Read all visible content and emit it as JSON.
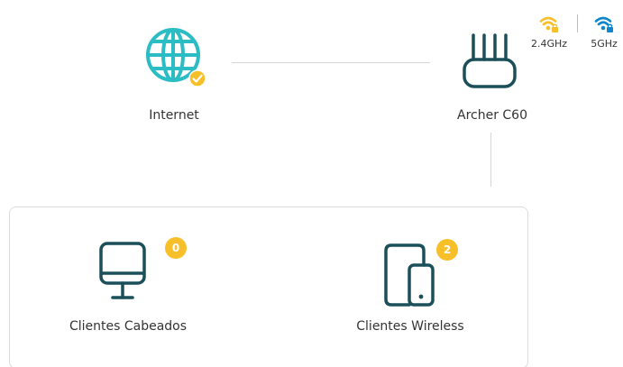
{
  "nodes": {
    "internet": {
      "label": "Internet",
      "status": "connected"
    },
    "router": {
      "label": "Archer C60"
    }
  },
  "wifi": [
    {
      "band": "2.4GHz",
      "color": "#f7c02b"
    },
    {
      "band": "5GHz",
      "color": "#0e86c9"
    }
  ],
  "clients": {
    "wired": {
      "label": "Clientes Cabeados",
      "count": "0"
    },
    "wireless": {
      "label": "Clientes Wireless",
      "count": "2"
    }
  },
  "colors": {
    "icon_teal": "#1b4f5a",
    "globe_teal": "#2bbcc4",
    "badge_yellow": "#f7c02b",
    "line_gray": "#d5d5d5"
  }
}
